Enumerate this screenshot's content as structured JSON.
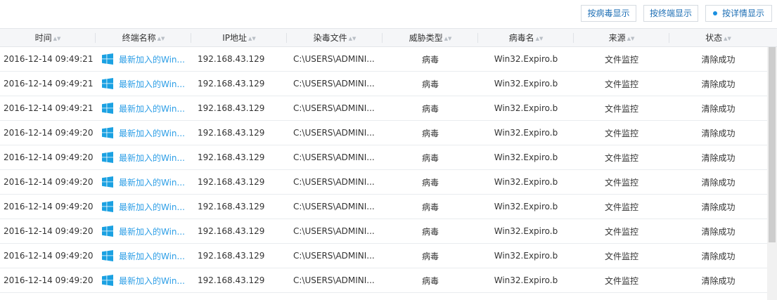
{
  "toolbar": {
    "btn_by_virus": "按病毒显示",
    "btn_by_terminal": "按终端显示",
    "btn_by_detail": "按详情显示"
  },
  "columns": {
    "time": "时间",
    "terminal": "终端名称",
    "ip": "IP地址",
    "file": "染毒文件",
    "threat_type": "威胁类型",
    "virus_name": "病毒名",
    "source": "来源",
    "status": "状态"
  },
  "rows": [
    {
      "time": "2016-12-14 09:49:21",
      "terminal": "最新加入的Win...",
      "ip": "192.168.43.129",
      "file": "C:\\USERS\\ADMINI...",
      "threat_type": "病毒",
      "virus_name": "Win32.Expiro.b",
      "source": "文件监控",
      "status": "清除成功"
    },
    {
      "time": "2016-12-14 09:49:21",
      "terminal": "最新加入的Win...",
      "ip": "192.168.43.129",
      "file": "C:\\USERS\\ADMINI...",
      "threat_type": "病毒",
      "virus_name": "Win32.Expiro.b",
      "source": "文件监控",
      "status": "清除成功"
    },
    {
      "time": "2016-12-14 09:49:21",
      "terminal": "最新加入的Win...",
      "ip": "192.168.43.129",
      "file": "C:\\USERS\\ADMINI...",
      "threat_type": "病毒",
      "virus_name": "Win32.Expiro.b",
      "source": "文件监控",
      "status": "清除成功"
    },
    {
      "time": "2016-12-14 09:49:20",
      "terminal": "最新加入的Win...",
      "ip": "192.168.43.129",
      "file": "C:\\USERS\\ADMINI...",
      "threat_type": "病毒",
      "virus_name": "Win32.Expiro.b",
      "source": "文件监控",
      "status": "清除成功"
    },
    {
      "time": "2016-12-14 09:49:20",
      "terminal": "最新加入的Win...",
      "ip": "192.168.43.129",
      "file": "C:\\USERS\\ADMINI...",
      "threat_type": "病毒",
      "virus_name": "Win32.Expiro.b",
      "source": "文件监控",
      "status": "清除成功"
    },
    {
      "time": "2016-12-14 09:49:20",
      "terminal": "最新加入的Win...",
      "ip": "192.168.43.129",
      "file": "C:\\USERS\\ADMINI...",
      "threat_type": "病毒",
      "virus_name": "Win32.Expiro.b",
      "source": "文件监控",
      "status": "清除成功"
    },
    {
      "time": "2016-12-14 09:49:20",
      "terminal": "最新加入的Win...",
      "ip": "192.168.43.129",
      "file": "C:\\USERS\\ADMINI...",
      "threat_type": "病毒",
      "virus_name": "Win32.Expiro.b",
      "source": "文件监控",
      "status": "清除成功"
    },
    {
      "time": "2016-12-14 09:49:20",
      "terminal": "最新加入的Win...",
      "ip": "192.168.43.129",
      "file": "C:\\USERS\\ADMINI...",
      "threat_type": "病毒",
      "virus_name": "Win32.Expiro.b",
      "source": "文件监控",
      "status": "清除成功"
    },
    {
      "time": "2016-12-14 09:49:20",
      "terminal": "最新加入的Win...",
      "ip": "192.168.43.129",
      "file": "C:\\USERS\\ADMINI...",
      "threat_type": "病毒",
      "virus_name": "Win32.Expiro.b",
      "source": "文件监控",
      "status": "清除成功"
    },
    {
      "time": "2016-12-14 09:49:20",
      "terminal": "最新加入的Win...",
      "ip": "192.168.43.129",
      "file": "C:\\USERS\\ADMINI...",
      "threat_type": "病毒",
      "virus_name": "Win32.Expiro.b",
      "source": "文件监控",
      "status": "清除成功"
    }
  ],
  "icons": {
    "terminal_os": "windows-icon",
    "sort": "sort-icon",
    "active_view": "dot-icon"
  },
  "colors": {
    "link": "#2d9ee6",
    "button_text": "#1e6fb5",
    "windows_logo": "#1ba1e2",
    "active_dot": "#1a8fe0"
  }
}
